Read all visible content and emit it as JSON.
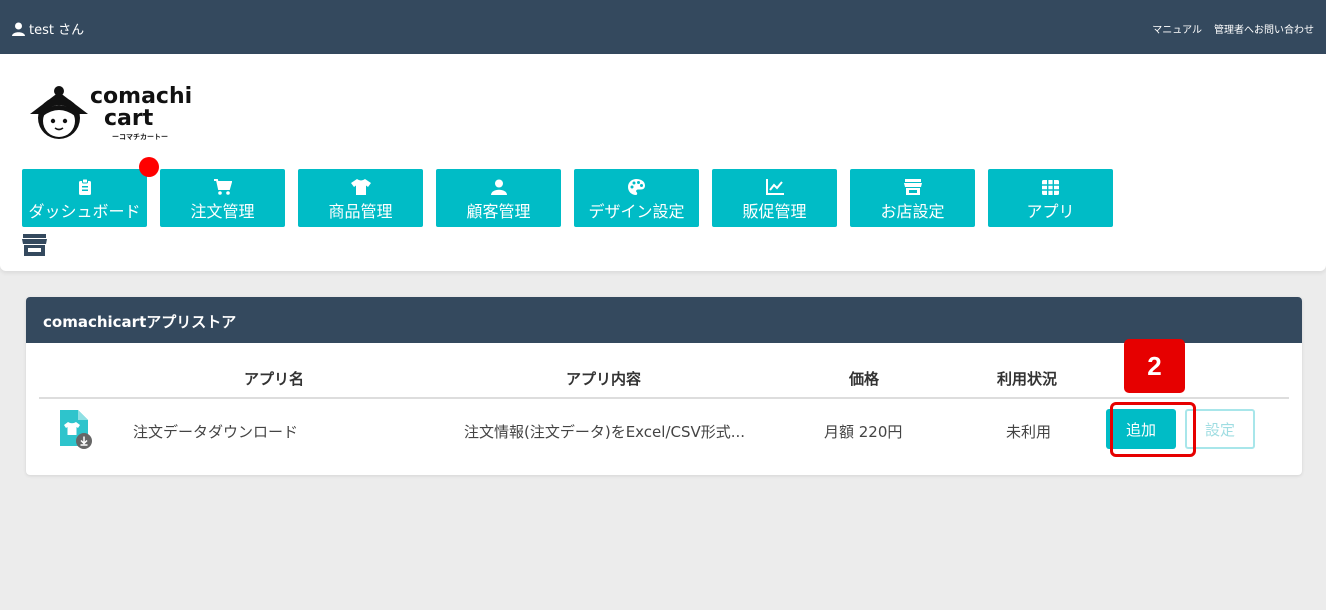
{
  "topbar": {
    "user_label": "test さん",
    "links": [
      "マニュアル",
      "管理者へお問い合わせ"
    ]
  },
  "logo": {
    "line1": "comachi",
    "line2": "cart",
    "kana": "ーコマチカートー"
  },
  "nav": [
    {
      "label": "ダッシュボード",
      "icon": "clipboard-icon"
    },
    {
      "label": "注文管理",
      "icon": "cart-icon"
    },
    {
      "label": "商品管理",
      "icon": "shirt-icon"
    },
    {
      "label": "顧客管理",
      "icon": "user-icon"
    },
    {
      "label": "デザイン設定",
      "icon": "palette-icon"
    },
    {
      "label": "販促管理",
      "icon": "chart-line-icon"
    },
    {
      "label": "お店設定",
      "icon": "store-icon"
    },
    {
      "label": "アプリ",
      "icon": "grid-icon"
    }
  ],
  "panel": {
    "title": "comachicartアプリストア",
    "columns": {
      "name": "アプリ名",
      "content": "アプリ内容",
      "price": "価格",
      "status": "利用状況"
    },
    "rows": [
      {
        "name": "注文データダウンロード",
        "content": "注文情報(注文データ)をExcel/CSV形式...",
        "price": "月額 220円",
        "status": "未利用",
        "add_label": "追加",
        "settings_label": "設定"
      }
    ]
  },
  "callout_number": "2",
  "colors": {
    "topbar": "#34495e",
    "accent": "#00bcc6",
    "highlight": "#e60000"
  }
}
